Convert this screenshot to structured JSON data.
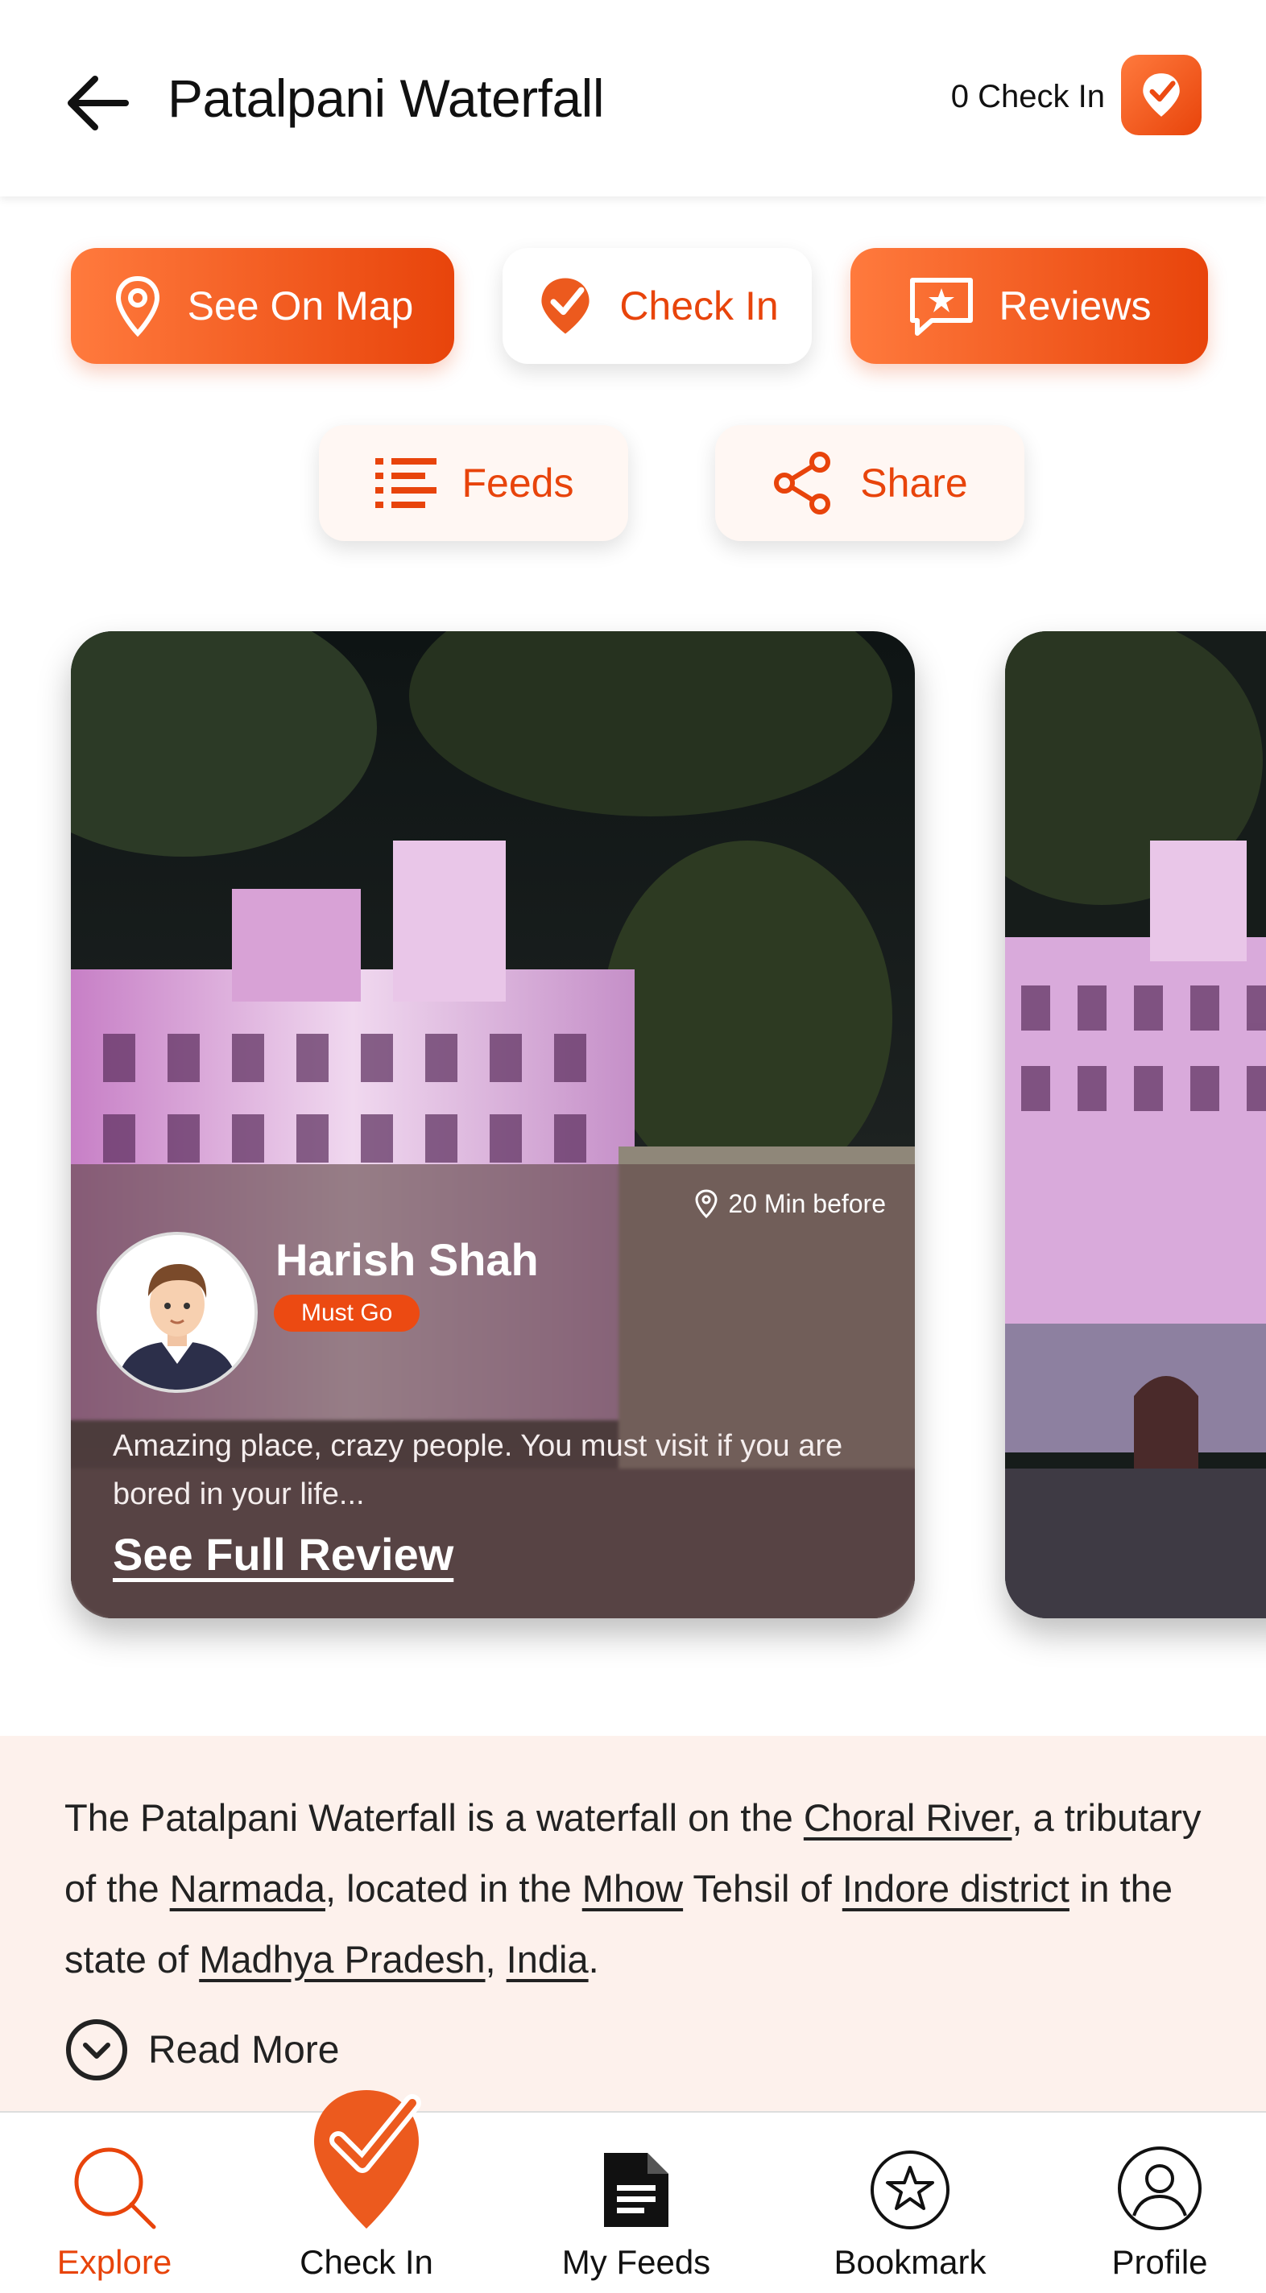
{
  "header": {
    "title": "Patalpani Waterfall",
    "checkin_count": "0 Check In"
  },
  "actions": {
    "see_on_map": "See On Map",
    "check_in": "Check In",
    "reviews": "Reviews",
    "feeds": "Feeds",
    "share": "Share"
  },
  "review_card": {
    "time_ago": "20 Min before",
    "reviewer_name": "Harish Shah",
    "tag": "Must Go",
    "text": "Amazing place, crazy people. You must visit if you are bored in your life...",
    "link": "See Full Review"
  },
  "description": {
    "t1": "The Patalpani Waterfall is a waterfall on the ",
    "l1": "Choral River",
    "t2": ", a tributary of the ",
    "l2": "Narmada",
    "t3": ", located in the ",
    "l3": "Mhow",
    "t4": " Tehsil of ",
    "l4": "Indore district",
    "t5": " in the state of ",
    "l5": "Madhya Pradesh",
    "t6": ", ",
    "l6": "India",
    "t7": ".",
    "read_more": "Read More"
  },
  "nav": {
    "explore": "Explore",
    "check_in": "Check In",
    "my_feeds": "My Feeds",
    "bookmark": "Bookmark",
    "profile": "Profile"
  },
  "colors": {
    "accent": "#e8440b",
    "accent_light": "#ff7a3d",
    "description_bg": "#fdf1ec"
  }
}
